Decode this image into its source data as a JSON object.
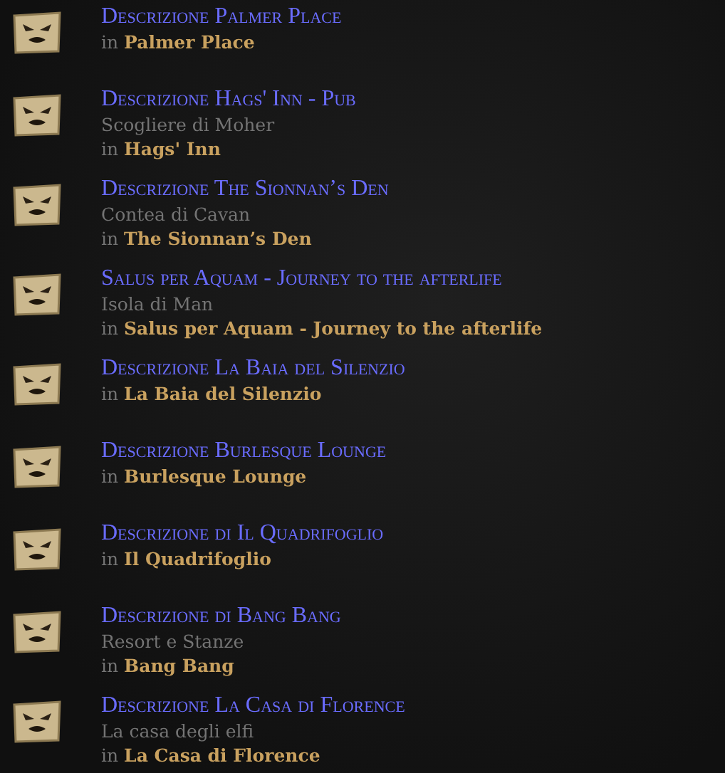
{
  "entries": [
    {
      "title": "Descrizione Palmer Place",
      "location": "in **Palmer Place**"
    },
    {
      "title": "Descrizione Hags' Inn - Pub",
      "region": "Scogliere di Moher",
      "location": "in **Hags' Inn**"
    },
    {
      "title": "Descrizione The Sionnan’s Den",
      "region": "Contea di Cavan",
      "location": "in **The Sionnan’s Den**"
    },
    {
      "title": "Salus per Aquam - Journey to the afterlife",
      "region": "Isola di Man",
      "location": "in **Salus per Aquam - Journey to the afterlife**"
    },
    {
      "title": "Descrizione La Baia del Silenzio",
      "location": "in **La Baia del Silenzio**"
    },
    {
      "title": "Descrizione Burlesque Lounge",
      "location": "in **Burlesque Lounge**"
    },
    {
      "title": "Descrizione di Il Quadrifoglio",
      "location": "in **Il Quadrifoglio**"
    },
    {
      "title": "Descrizione di Bang Bang",
      "region": "Resort e Stanze",
      "location": "in **Bang Bang**"
    },
    {
      "title": "Descrizione La Casa di Florence",
      "region": "La casa degli elfi",
      "location": "in **La Casa di Florence**"
    }
  ]
}
